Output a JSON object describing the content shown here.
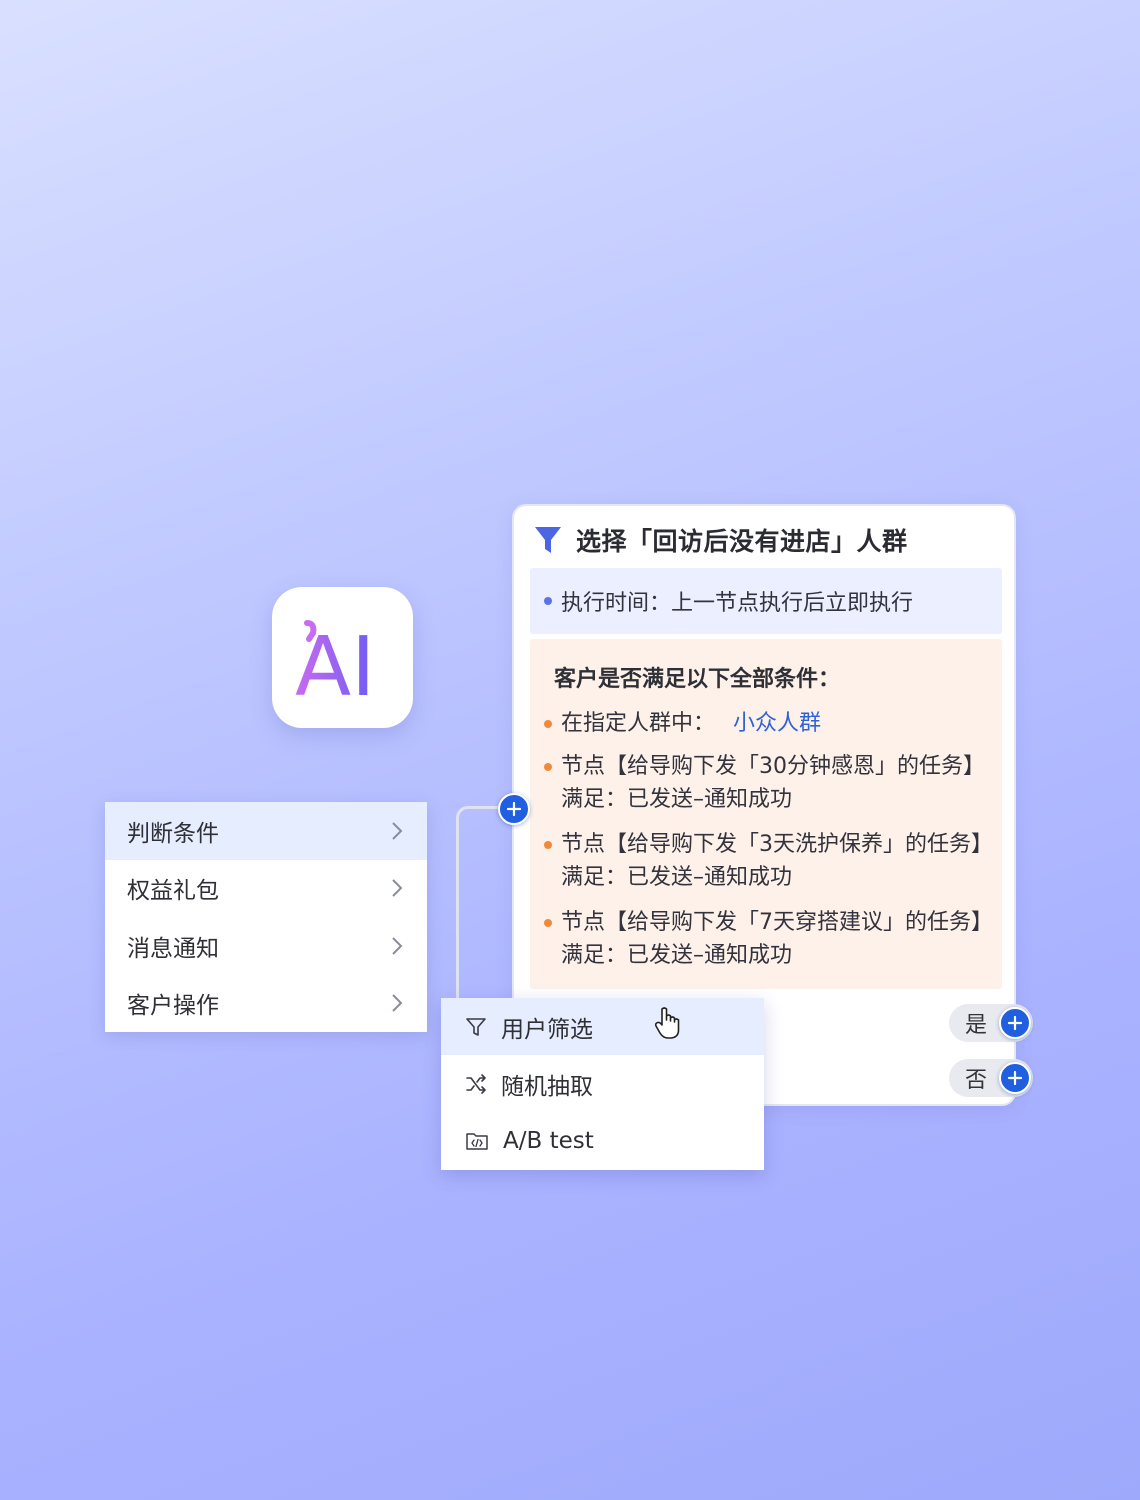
{
  "logo": {
    "text": "AI",
    "icon": "ai-logo-icon"
  },
  "node_card": {
    "title": "选择「回访后没有进店」人群",
    "icon": "funnel-icon",
    "execution_time": "执行时间：上一节点执行后立即执行",
    "conditions": {
      "heading": "客户是否满足以下全部条件：",
      "crowd_label": "在指定人群中：",
      "crowd_value": "小众人群",
      "items": [
        "节点【给导购下发「30分钟感恩」的任务】满足：已发送–通知成功",
        "节点【给导购下发「3天洗护保养」的任务】满足：已发送–通知成功",
        "节点【给导购下发「7天穿搭建议」的任务】满足：已发送–通知成功"
      ]
    },
    "branches": {
      "yes": "是",
      "no": "否"
    }
  },
  "left_menu": {
    "items": [
      {
        "label": "判断条件",
        "active": true
      },
      {
        "label": "权益礼包",
        "active": false
      },
      {
        "label": "消息通知",
        "active": false
      },
      {
        "label": "客户操作",
        "active": false
      }
    ]
  },
  "sub_menu": {
    "items": [
      {
        "label": "用户筛选",
        "icon": "filter-icon",
        "active": true
      },
      {
        "label": "随机抽取",
        "icon": "shuffle-icon",
        "active": false
      },
      {
        "label": "A/B test",
        "icon": "code-folder-icon",
        "active": false
      }
    ]
  },
  "colors": {
    "accent_blue": "#1f5fe0",
    "link_blue": "#2e62d9",
    "bullet_orange": "#f08a3a",
    "menu_active": "#e6edff"
  }
}
